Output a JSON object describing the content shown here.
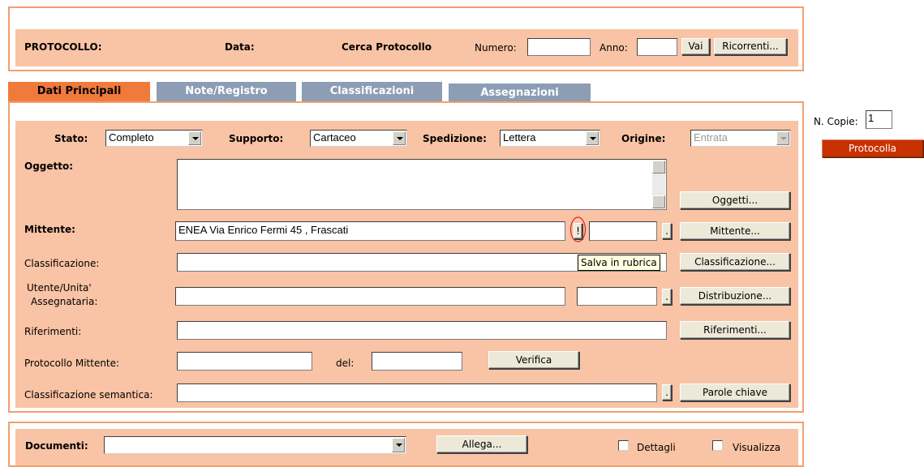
{
  "header": {
    "protocollo_label": "PROTOCOLLO:",
    "data_label": "Data:",
    "cerca_label": "Cerca Protocollo",
    "numero_label": "Numero:",
    "numero_value": "",
    "anno_label": "Anno:",
    "anno_value": "",
    "vai_button": "Vai",
    "ricorrenti_button": "Ricorrenti..."
  },
  "tabs": [
    {
      "label": "Dati Principali",
      "active": true
    },
    {
      "label": "Note/Registro",
      "active": false
    },
    {
      "label": "Classificazioni",
      "active": false
    },
    {
      "label": "Assegnazioni",
      "active": false
    }
  ],
  "form": {
    "stato_label": "Stato:",
    "stato_value": "Completo",
    "supporto_label": "Supporto:",
    "supporto_value": "Cartaceo",
    "spedizione_label": "Spedizione:",
    "spedizione_value": "Lettera",
    "origine_label": "Origine:",
    "origine_value": "Entrata",
    "oggetto_label": "Oggetto:",
    "oggetto_value": "",
    "oggetti_button": "Oggetti...",
    "mittente_label": "Mittente:",
    "mittente_value": "ENEA  Via Enrico Fermi 45 , Frascati",
    "save_icon_glyph": "!",
    "dot_glyph": ".",
    "mittente_button": "Mittente...",
    "tooltip_text": "Salva in rubrica",
    "classificazione_label": "Classificazione:",
    "classificazione_value": "",
    "classificazione_button": "Classificazione...",
    "utente_label_line1": "Utente/Unita'",
    "utente_label_line2": "Assegnataria:",
    "utente_value": "",
    "distribuzione_button": "Distribuzione...",
    "riferimenti_label": "Riferimenti:",
    "riferimenti_value": "",
    "riferimenti_button": "Riferimenti...",
    "prot_mittente_label": "Protocollo Mittente:",
    "prot_mittente_value": "",
    "del_label": "del:",
    "del_value": "",
    "verifica_button": "Verifica",
    "class_semantica_label": "Classificazione semantica:",
    "class_semantica_value": "",
    "parole_chiave_button": "Parole chiave"
  },
  "side": {
    "copie_label": "N. Copie:",
    "copie_value": "1",
    "protocolla_button": "Protocolla"
  },
  "documents": {
    "documenti_label": "Documenti:",
    "documenti_value": "",
    "allega_button": "Allega...",
    "dettagli_label": "Dettagli",
    "visualizza_label": "Visualizza"
  },
  "colors": {
    "panel_bg": "#f9c3a5",
    "frame_border": "#f0a070",
    "tab_active": "#f07a3c",
    "tab_inactive": "#8c9db4",
    "protocolla_btn": "#c83200"
  }
}
